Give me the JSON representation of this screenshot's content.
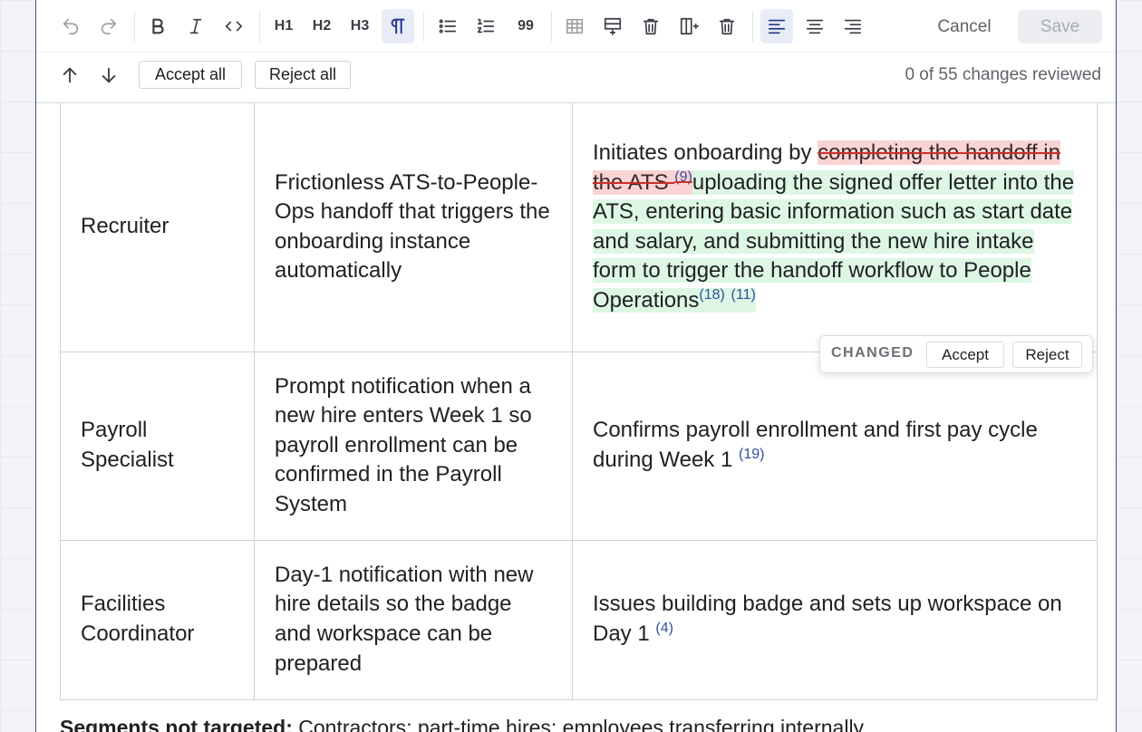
{
  "toolbar": {
    "icons": [
      "undo-icon",
      "redo-icon",
      "bold-icon",
      "italic-icon",
      "code-icon",
      "h1",
      "h2",
      "h3",
      "paragraph-icon",
      "bullet-list-icon",
      "numbered-list-icon",
      "quote-icon",
      "table-icon",
      "insert-row-icon",
      "delete-row-icon",
      "insert-column-icon",
      "delete-column-icon",
      "align-left-icon",
      "align-center-icon",
      "align-right-icon"
    ],
    "h1_label": "H1",
    "h2_label": "H2",
    "h3_label": "H3",
    "quote_label": "99",
    "cancel_label": "Cancel",
    "save_label": "Save"
  },
  "review": {
    "accept_all_label": "Accept all",
    "reject_all_label": "Reject all",
    "status": "0 of 55 changes reviewed"
  },
  "table": {
    "rows": [
      {
        "role": "Recruiter",
        "need": "Frictionless ATS-to-People-Ops handoff that triggers the onboarding instance automatically",
        "action_prefix": "Initiates onboarding by ",
        "action_deleted": "completing the handoff in the ATS ",
        "action_deleted_ref": "(9)",
        "action_inserted": "uploading the signed offer letter into the ATS, entering basic information such as start date and salary, and submitting the new hire intake form to trigger the handoff workflow to People Operations",
        "action_refs": [
          "(18)",
          "(11)"
        ]
      },
      {
        "role": "Payroll Specialist",
        "need": "Prompt notification when a new hire enters Week 1 so payroll enrollment can be confirmed in the Payroll System",
        "action": "Confirms payroll enrollment and first pay cycle during Week 1 ",
        "action_ref": "(19)"
      },
      {
        "role": "Facilities Coordinator",
        "need": "Day-1 notification with new hire details so the badge and workspace can be prepared",
        "action": "Issues building badge and sets up workspace on Day 1 ",
        "action_ref": "(4)"
      }
    ]
  },
  "popover": {
    "label": "CHANGED",
    "accept_label": "Accept",
    "reject_label": "Reject"
  },
  "segments": {
    "heading": "Segments not targeted:",
    "text": " Contractors; part-time hires; employees transferring internally"
  },
  "colors": {
    "deleted_bg": "#fad4d4",
    "inserted_bg": "#ddf7e4",
    "editor_border": "#3e4fa1",
    "reference": "#2d4fa0"
  }
}
